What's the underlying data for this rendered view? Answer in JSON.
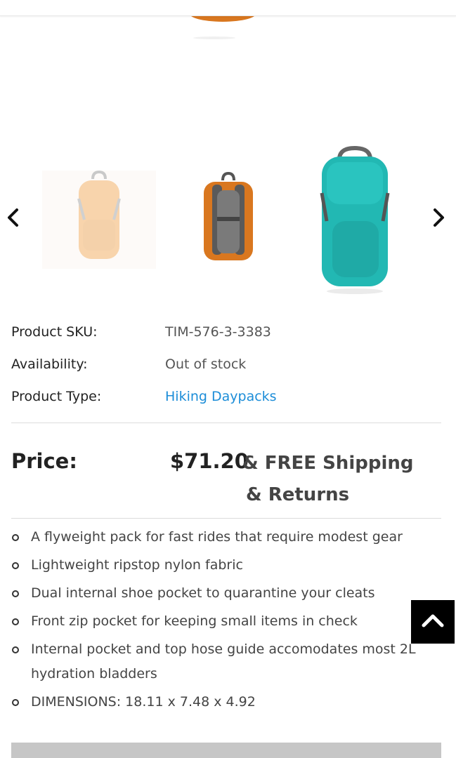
{
  "gallery": {
    "prev_icon": "chevron-left-icon",
    "next_icon": "chevron-right-icon",
    "thumbnails": [
      {
        "icon": "backpack-front-orange-faded",
        "color": "#f0a24a"
      },
      {
        "icon": "backpack-back-orange",
        "color": "#d9771f"
      },
      {
        "icon": "backpack-front-teal",
        "color": "#22b8b3"
      }
    ]
  },
  "details": {
    "sku_label": "Product SKU:",
    "sku_value": "TIM-576-3-3383",
    "availability_label": "Availability:",
    "availability_value": "Out of stock",
    "type_label": "Product Type:",
    "type_value": "Hiking Daypacks"
  },
  "price": {
    "label": "Price:",
    "value": "$71.20",
    "shipping_line1": "& FREE Shipping",
    "shipping_line2": "& Returns"
  },
  "features": [
    "A flyweight pack for fast rides that require modest gear",
    "Lightweight ripstop nylon fabric",
    "Dual internal shoe pocket to quarantine your cleats",
    "Front zip pocket for keeping small items in check",
    "Internal pocket and top hose guide accomodates most 2L hydration bladders",
    "DIMENSIONS: 18.11 x 7.48 x 4.92"
  ],
  "colors": {
    "link": "#1c8dd8",
    "back_to_top_bg": "#000000"
  },
  "back_to_top_icon": "chevron-up-icon"
}
